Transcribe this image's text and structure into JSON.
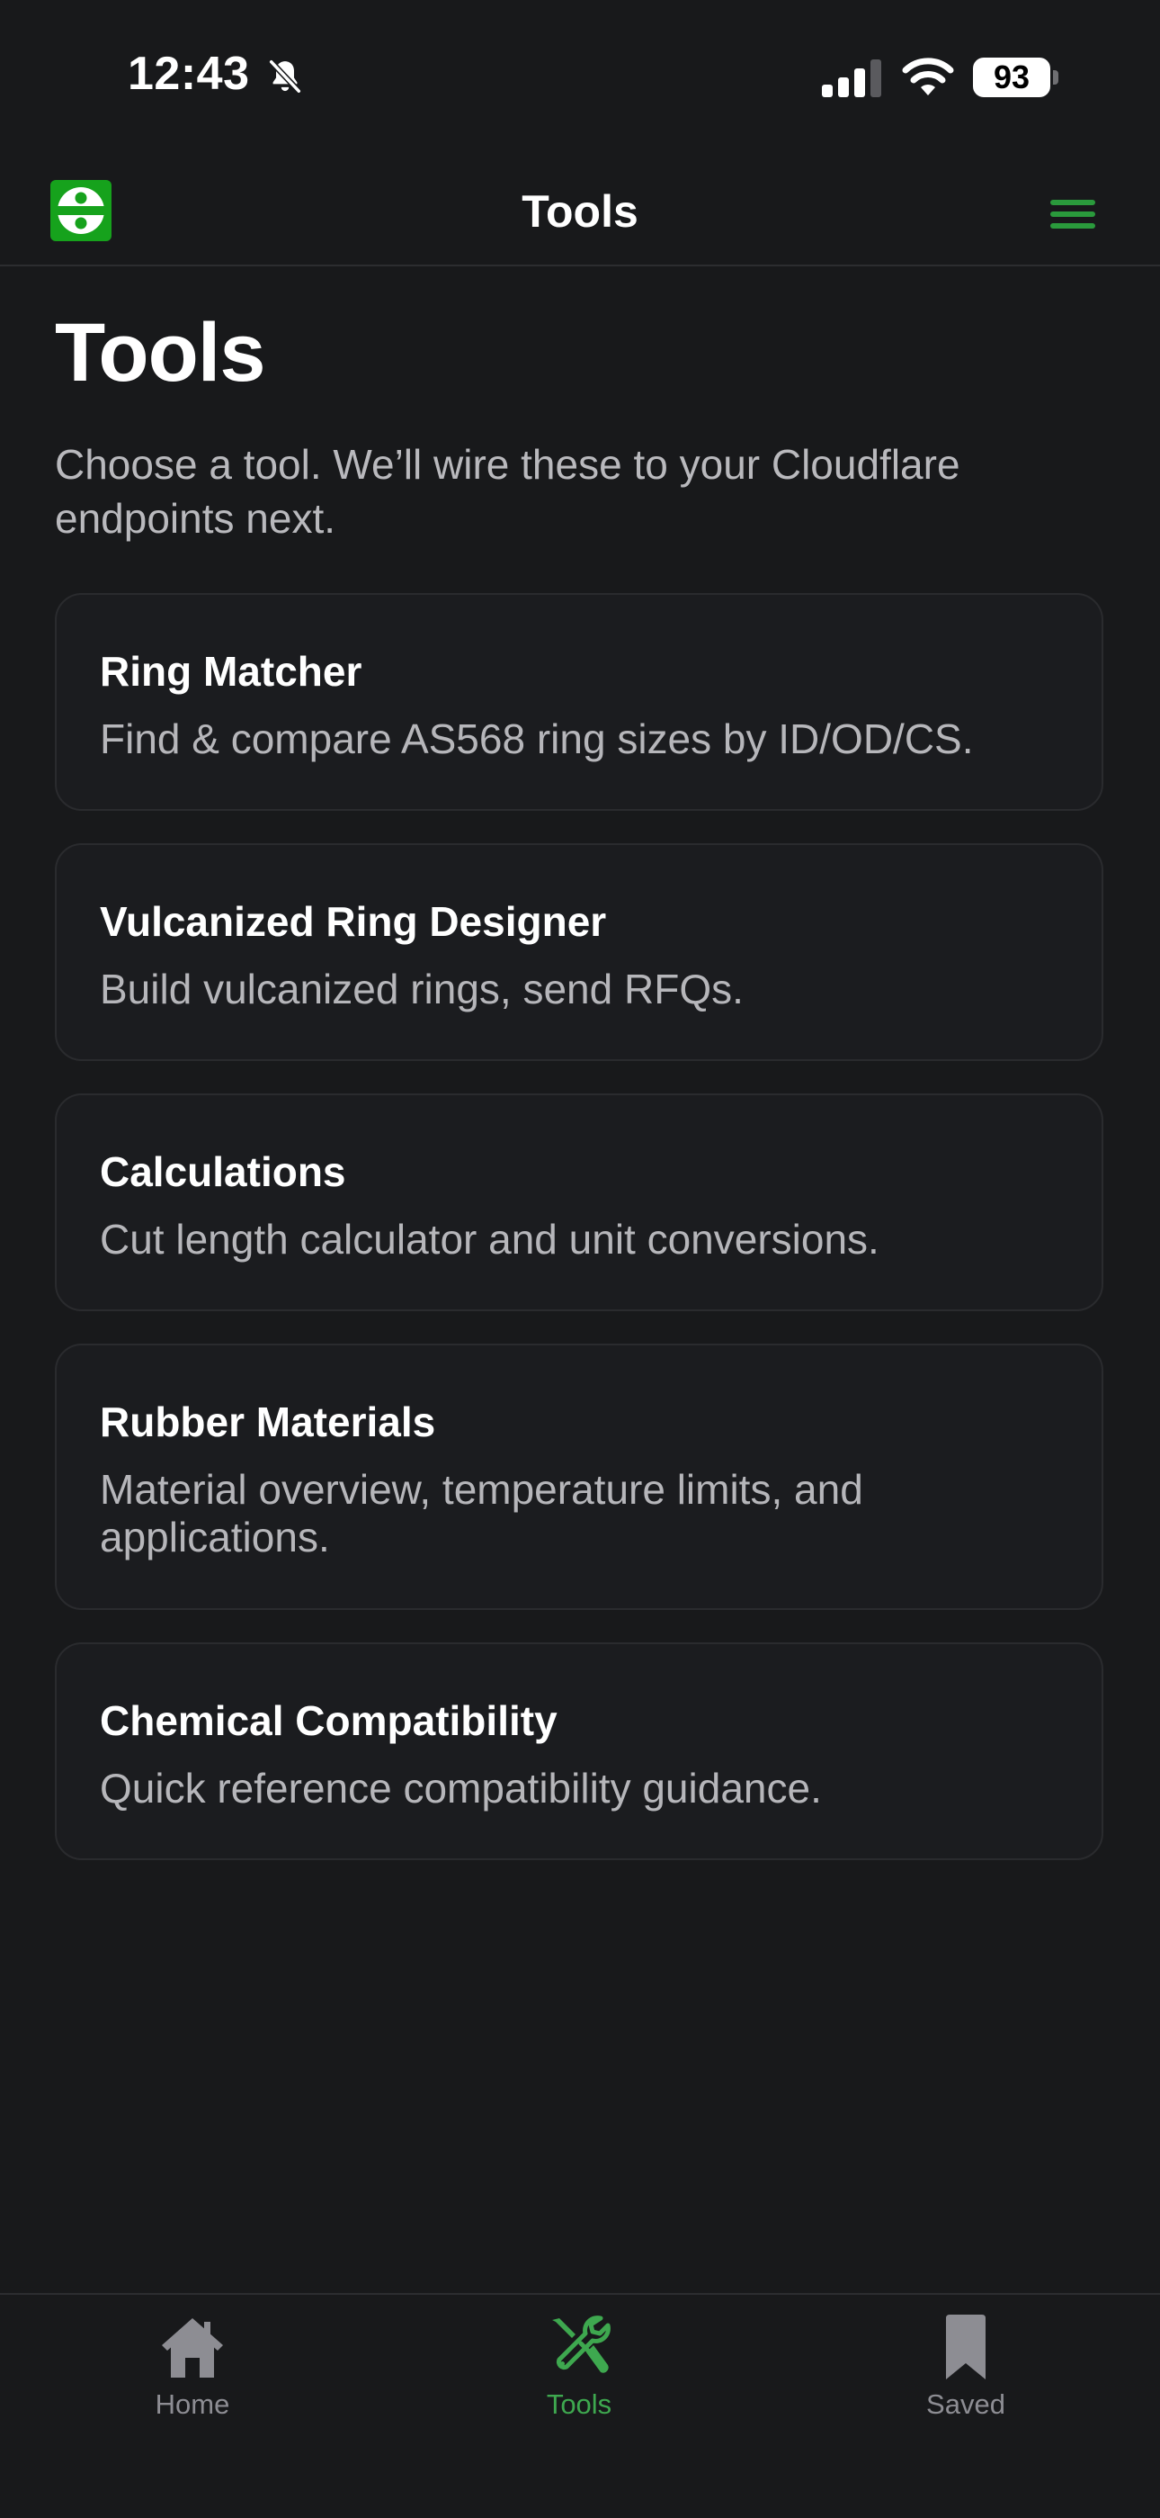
{
  "status_bar": {
    "time": "12:43",
    "battery": "93",
    "icons": [
      "bell-slash-icon",
      "signal-icon",
      "wifi-icon",
      "battery-icon"
    ]
  },
  "header": {
    "title": "Tools",
    "logo_icon": "app-logo",
    "menu_icon": "hamburger-menu-icon",
    "accent_color": "#2a9a3c"
  },
  "main": {
    "title": "Tools",
    "subtitle": "Choose a tool. We’ll wire these to your Cloudflare endpoints next.",
    "tools": [
      {
        "title": "Ring Matcher",
        "description": "Find & compare AS568 ring sizes by ID/OD/CS."
      },
      {
        "title": "Vulcanized Ring Designer",
        "description": "Build vulcanized rings, send RFQs."
      },
      {
        "title": "Calculations",
        "description": "Cut length calculator and unit conversions."
      },
      {
        "title": "Rubber Materials",
        "description": "Material overview, temperature limits, and applications."
      },
      {
        "title": "Chemical Compatibility",
        "description": "Quick reference compatibility guidance."
      }
    ]
  },
  "tab_bar": {
    "items": [
      {
        "label": "Home",
        "icon": "house-icon",
        "active": false
      },
      {
        "label": "Tools",
        "icon": "tools-icon",
        "active": true
      },
      {
        "label": "Saved",
        "icon": "bookmark-icon",
        "active": false
      }
    ],
    "active_color": "#3ea84f",
    "inactive_color": "#8d8d93"
  }
}
